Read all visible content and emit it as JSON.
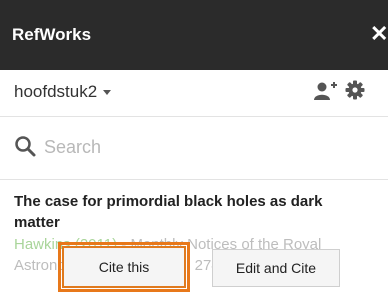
{
  "window": {
    "title": "RefWorks"
  },
  "header": {
    "folder_name": "hoofdstuk2"
  },
  "search": {
    "placeholder": "Search"
  },
  "reference": {
    "title": "The case for primordial black holes as dark matter",
    "authors": "Hawkins (2011)",
    "journal": " - Monthly Notices of the Royal Astronomical Society, 415, 2744-2757"
  },
  "actions": {
    "cite_label": "Cite this",
    "edit_cite_label": "Edit and Cite"
  },
  "icons": {
    "close": "close-icon",
    "caret": "caret-down-icon",
    "add_user": "add-user-icon",
    "settings": "gear-icon",
    "search": "search-icon"
  },
  "colors": {
    "titlebar": "#2b2b2b",
    "accent_orange": "#e8781a",
    "author_green": "#a9d59a",
    "icon_gray": "#555555"
  }
}
